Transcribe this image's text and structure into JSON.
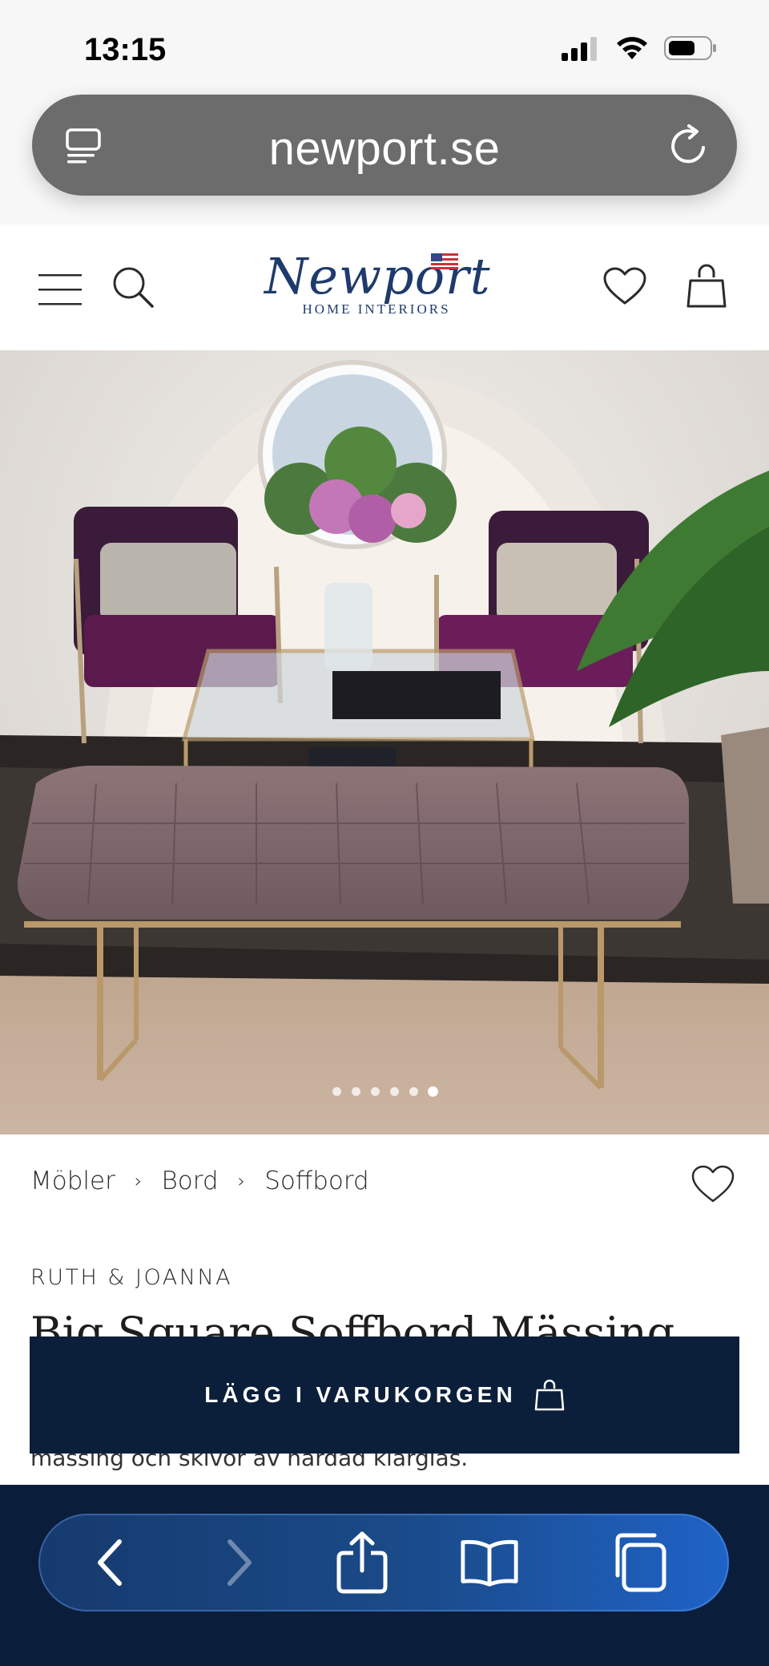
{
  "status_bar": {
    "time": "13:15"
  },
  "browser": {
    "url": "newport.se"
  },
  "header": {
    "logo_word": "Newport",
    "logo_sub": "HOME INTERIORS"
  },
  "hero": {
    "slide_count": 6,
    "active_slide": 6
  },
  "breadcrumb": [
    "Möbler",
    "Bord",
    "Soffbord"
  ],
  "product": {
    "brand": "RUTH & JOANNA",
    "title": "Big Square Soffbord Mässing",
    "description_partial": "mässing och skivor av härdad klarglas."
  },
  "cta": {
    "label": "LÄGG I VARUKORGEN"
  },
  "colors": {
    "navy": "#0b1f3a",
    "logo_blue": "#1f3b6b",
    "toolbar_bg": "#0a1e3b"
  }
}
